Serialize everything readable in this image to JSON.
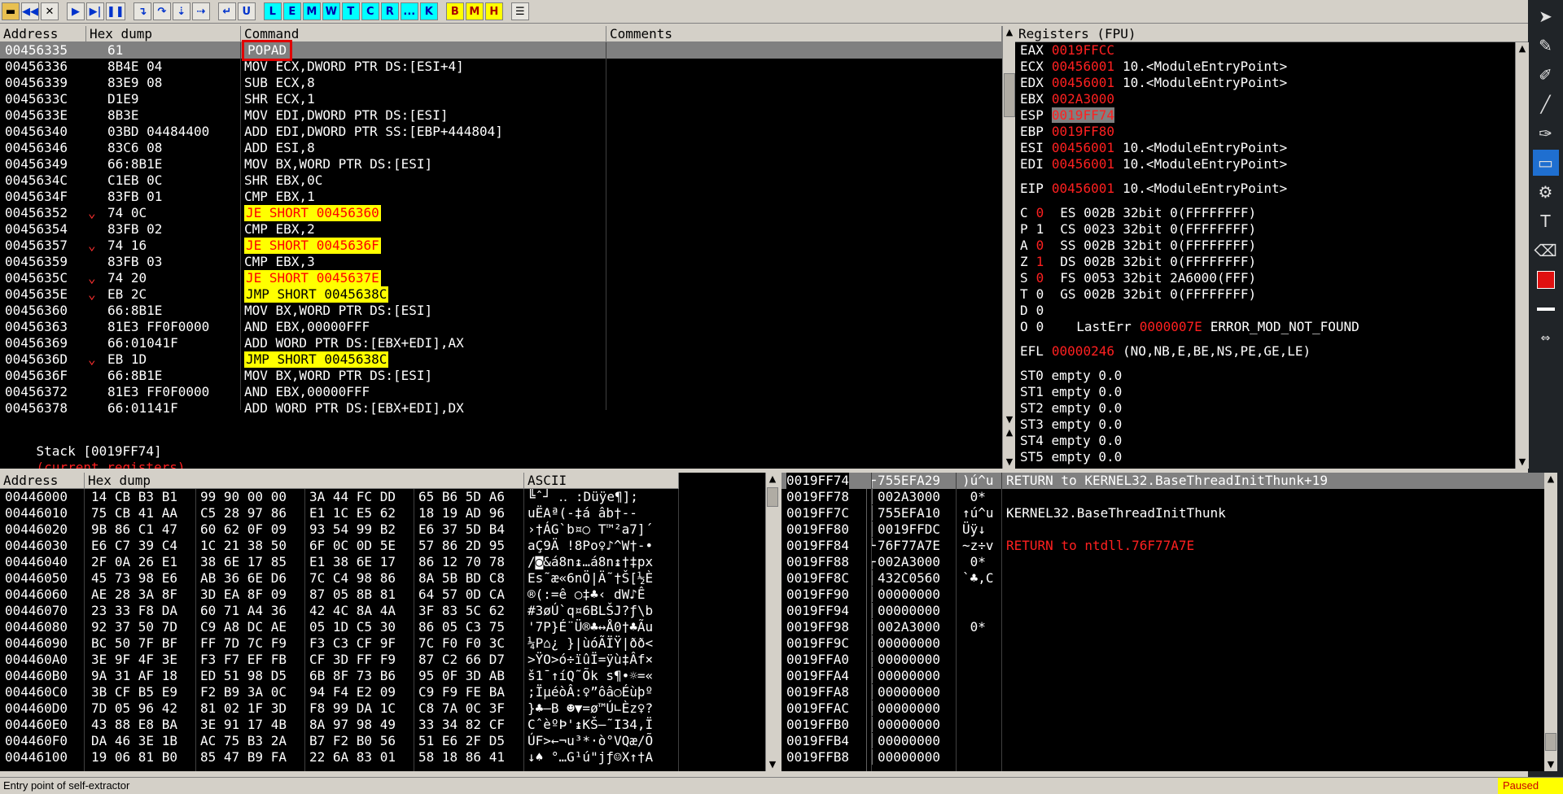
{
  "toolbar": {
    "buttons": [
      "L",
      "E",
      "M",
      "W",
      "T",
      "C",
      "R",
      "...",
      "K",
      "B",
      "M",
      "H"
    ]
  },
  "disasm": {
    "headers": {
      "address": "Address",
      "hex": "Hex dump",
      "command": "Command",
      "comments": "Comments"
    },
    "rows": [
      {
        "addr": "00456335",
        "hex": "61",
        "cmd": "POPAD",
        "style": "boxed",
        "sel": true
      },
      {
        "addr": "00456336",
        "hex": "8B4E 04",
        "cmd": "MOV ECX,DWORD PTR DS:[ESI+4]"
      },
      {
        "addr": "00456339",
        "hex": "83E9 08",
        "cmd": "SUB ECX,8"
      },
      {
        "addr": "0045633C",
        "hex": "D1E9",
        "cmd": "SHR ECX,1"
      },
      {
        "addr": "0045633E",
        "hex": "8B3E",
        "cmd": "MOV EDI,DWORD PTR DS:[ESI]"
      },
      {
        "addr": "00456340",
        "hex": "03BD 04484400",
        "cmd": "ADD EDI,DWORD PTR SS:[EBP+444804]"
      },
      {
        "addr": "00456346",
        "hex": "83C6 08",
        "cmd": "ADD ESI,8"
      },
      {
        "addr": "00456349",
        "hex": "66:8B1E",
        "cmd": "MOV BX,WORD PTR DS:[ESI]"
      },
      {
        "addr": "0045634C",
        "hex": "C1EB 0C",
        "cmd": "SHR EBX,0C"
      },
      {
        "addr": "0045634F",
        "hex": "83FB 01",
        "cmd": "CMP EBX,1"
      },
      {
        "addr": "00456352",
        "hex": "74 0C",
        "cmd": "JE SHORT 00456360",
        "style": "jmp",
        "arrow": true
      },
      {
        "addr": "00456354",
        "hex": "83FB 02",
        "cmd": "CMP EBX,2"
      },
      {
        "addr": "00456357",
        "hex": "74 16",
        "cmd": "JE SHORT 0045636F",
        "style": "jmp",
        "arrow": true
      },
      {
        "addr": "00456359",
        "hex": "83FB 03",
        "cmd": "CMP EBX,3"
      },
      {
        "addr": "0045635C",
        "hex": "74 20",
        "cmd": "JE SHORT 0045637E",
        "style": "jmp",
        "arrow": true
      },
      {
        "addr": "0045635E",
        "hex": "EB 2C",
        "cmd": "JMP SHORT 0045638C",
        "style": "jmp2",
        "arrow": true
      },
      {
        "addr": "00456360",
        "hex": "66:8B1E",
        "cmd": "MOV BX,WORD PTR DS:[ESI]"
      },
      {
        "addr": "00456363",
        "hex": "81E3 FF0F0000",
        "cmd": "AND EBX,00000FFF"
      },
      {
        "addr": "00456369",
        "hex": "66:01041F",
        "cmd": "ADD WORD PTR DS:[EBX+EDI],AX"
      },
      {
        "addr": "0045636D",
        "hex": "EB 1D",
        "cmd": "JMP SHORT 0045638C",
        "style": "jmp2",
        "arrow": true
      },
      {
        "addr": "0045636F",
        "hex": "66:8B1E",
        "cmd": "MOV BX,WORD PTR DS:[ESI]"
      },
      {
        "addr": "00456372",
        "hex": "81E3 FF0F0000",
        "cmd": "AND EBX,00000FFF"
      },
      {
        "addr": "00456378",
        "hex": "66:01141F",
        "cmd": "ADD WORD PTR DS:[EBX+EDI],DX"
      }
    ],
    "info_prefix": "Stack [0019FF74]",
    "info_suffix": "(current registers)"
  },
  "registers": {
    "title": "Registers (FPU)",
    "gp": [
      {
        "name": "EAX",
        "val": "0019FFCC",
        "rest": ""
      },
      {
        "name": "ECX",
        "val": "00456001",
        "rest": "10.<ModuleEntryPoint>"
      },
      {
        "name": "EDX",
        "val": "00456001",
        "rest": "10.<ModuleEntryPoint>"
      },
      {
        "name": "EBX",
        "val": "002A3000",
        "rest": ""
      },
      {
        "name": "ESP",
        "val": "0019FF74",
        "rest": "",
        "hl": true
      },
      {
        "name": "EBP",
        "val": "0019FF80",
        "rest": ""
      },
      {
        "name": "ESI",
        "val": "00456001",
        "rest": "10.<ModuleEntryPoint>"
      },
      {
        "name": "EDI",
        "val": "00456001",
        "rest": "10.<ModuleEntryPoint>"
      }
    ],
    "eip": {
      "name": "EIP",
      "val": "00456001",
      "rest": "10.<ModuleEntryPoint>"
    },
    "flags": [
      {
        "f": "C",
        "v": "0",
        "red": true,
        "seg": "ES 002B 32bit 0(FFFFFFFF)"
      },
      {
        "f": "P",
        "v": "1",
        "red": false,
        "seg": "CS 0023 32bit 0(FFFFFFFF)"
      },
      {
        "f": "A",
        "v": "0",
        "red": true,
        "seg": "SS 002B 32bit 0(FFFFFFFF)"
      },
      {
        "f": "Z",
        "v": "1",
        "red": true,
        "seg": "DS 002B 32bit 0(FFFFFFFF)"
      },
      {
        "f": "S",
        "v": "0",
        "red": true,
        "seg": "FS 0053 32bit 2A6000(FFF)"
      },
      {
        "f": "T",
        "v": "0",
        "red": false,
        "seg": "GS 002B 32bit 0(FFFFFFFF)"
      },
      {
        "f": "D",
        "v": "0",
        "red": false,
        "seg": ""
      },
      {
        "f": "O",
        "v": "0",
        "red": false,
        "seg": ""
      }
    ],
    "lasterr": {
      "label": "LastErr",
      "val": "0000007E",
      "text": "ERROR_MOD_NOT_FOUND"
    },
    "efl": {
      "label": "EFL",
      "val": "00000246",
      "text": "(NO,NB,E,BE,NS,PE,GE,LE)"
    },
    "fpu": [
      "ST0 empty 0.0",
      "ST1 empty 0.0",
      "ST2 empty 0.0",
      "ST3 empty 0.0",
      "ST4 empty 0.0",
      "ST5 empty 0.0"
    ]
  },
  "dump": {
    "headers": {
      "address": "Address",
      "hex": "Hex dump",
      "ascii": "ASCII"
    },
    "rows": [
      {
        "addr": "00446000",
        "h1": "14 CB B3 B1",
        "h2": "99 90 00 00",
        "h3": "3A 44 FC DD",
        "h4": "65 B6 5D A6",
        "ascii": "╚ˆ┘ ‥ :Düÿe¶];"
      },
      {
        "addr": "00446010",
        "h1": "75 CB 41 AA",
        "h2": "C5 28 97 86",
        "h3": "E1 1C E5 62",
        "h4": "18 19 AD 96",
        "ascii": "uËAª(-‡á âb†--"
      },
      {
        "addr": "00446020",
        "h1": "9B 86 C1 47",
        "h2": "60 62 0F 09",
        "h3": "93 54 99 B2",
        "h4": "E6 37 5D B4",
        "ascii": "›†ÁG`b¤○ T™²a7]´"
      },
      {
        "addr": "00446030",
        "h1": "E6 C7 39 C4",
        "h2": "1C 21 38 50",
        "h3": "6F 0C 0D 5E",
        "h4": "57 86 2D 95",
        "ascii": "aÇ9Ä !8Po♀♪^W†-•"
      },
      {
        "addr": "00446040",
        "h1": "2F 0A 26 E1",
        "h2": "38 6E 17 85",
        "h3": "E1 38 6E 17",
        "h4": "86 12 70 78",
        "ascii": "/◙&á8n↨…á8n↨†‡px"
      },
      {
        "addr": "00446050",
        "h1": "45 73 98 E6",
        "h2": "AB 36 6E D6",
        "h3": "7C C4 98 86",
        "h4": "8A 5B BD C8",
        "ascii": "Es˜æ«6nÖ|Ä˜†Š[½È"
      },
      {
        "addr": "00446060",
        "h1": "AE 28 3A 8F",
        "h2": "3D EA 8F 09",
        "h3": "87 05 8B 81",
        "h4": "64 57 0D CA",
        "ascii": "®(:=ê ○‡♣‹ dW♪Ê"
      },
      {
        "addr": "00446070",
        "h1": "23 33 F8 DA",
        "h2": "60 71 A4 36",
        "h3": "42 4C 8A 4A",
        "h4": "3F 83 5C 62",
        "ascii": "#3øÚ`q¤6BLŠJ?ƒ\\b"
      },
      {
        "addr": "00446080",
        "h1": "92 37 50 7D",
        "h2": "C9 A8 DC AE",
        "h3": "05 1D C5 30",
        "h4": "86 05 C3 75",
        "ascii": "'7P}É¨Ü®♣↔Å0†♣Ãu"
      },
      {
        "addr": "00446090",
        "h1": "BC 50 7F BF",
        "h2": "FF 7D 7C F9",
        "h3": "F3 C3 CF 9F",
        "h4": "7C F0 F0 3C",
        "ascii": "¼P⌂¿ }|ùóÃÏŸ|ðð<"
      },
      {
        "addr": "004460A0",
        "h1": "3E 9F 4F 3E",
        "h2": "F3 F7 EF FB",
        "h3": "CF 3D FF F9",
        "h4": "87 C2 66 D7",
        "ascii": ">ŸO>ó÷ïûÏ=ÿù‡Âf×"
      },
      {
        "addr": "004460B0",
        "h1": "9A 31 AF 18",
        "h2": "ED 51 98 D5",
        "h3": "6B 8F 73 B6",
        "h4": "95 0F 3D AB",
        "ascii": "š1¯↑íQ˜Õk s¶•☼=«"
      },
      {
        "addr": "004460C0",
        "h1": "3B CF B5 E9",
        "h2": "F2 B9 3A 0C",
        "h3": "94 F4 E2 09",
        "h4": "C9 F9 FE BA",
        "ascii": ";ÏµéòÂ:♀”ôâ○Éùþº"
      },
      {
        "addr": "004460D0",
        "h1": "7D 05 96 42",
        "h2": "81 02 1F 3D",
        "h3": "F8 99 DA 1C",
        "h4": "C8 7A 0C 3F",
        "ascii": "}♣–B ☻▼=ø™Ú∟Èz♀?"
      },
      {
        "addr": "004460E0",
        "h1": "43 88 E8 BA",
        "h2": "3E 91 17 4B",
        "h3": "8A 97 98 49",
        "h4": "33 34 82 CF",
        "ascii": "CˆèºÞ'↨KŠ—˜I34‚Ï"
      },
      {
        "addr": "004460F0",
        "h1": "DA 46 3E 1B",
        "h2": "AC 75 B3 2A",
        "h3": "B7 F2 B0 56",
        "h4": "51 E6 2F D5",
        "ascii": "ÚF>←¬u³*·ò°VQæ/Õ"
      },
      {
        "addr": "00446100",
        "h1": "19 06 81 B0",
        "h2": "85 47 B9 FA",
        "h3": "22 6A 83 01",
        "h4": "58 18 86 41",
        "ascii": "↓♠ °…G¹ú\"jƒ☺X↑†A"
      }
    ]
  },
  "stack": {
    "rows": [
      {
        "addr": "0019FF74",
        "val": "755EFA29",
        "asc": ")ú^u",
        "cmt": "RETURN to KERNEL32.BaseThreadInitThunk+19",
        "red": false,
        "sel": true,
        "brk": "┌"
      },
      {
        "addr": "0019FF78",
        "val": "002A3000",
        "asc": " 0*",
        "cmt": "",
        "brk": "│"
      },
      {
        "addr": "0019FF7C",
        "val": "755EFA10",
        "asc": "↑ú^u",
        "cmt": "KERNEL32.BaseThreadInitThunk",
        "brk": "│"
      },
      {
        "addr": "0019FF80",
        "val": "0019FFDC",
        "asc": "Üÿ↓",
        "cmt": "",
        "brk": "│"
      },
      {
        "addr": "0019FF84",
        "val": "76F77A7E",
        "asc": "~z÷v",
        "cmt": "RETURN to ntdll.76F77A7E",
        "red": true,
        "brk": "└"
      },
      {
        "addr": "0019FF88",
        "val": "002A3000",
        "asc": " 0*",
        "cmt": "",
        "brk": "┌"
      },
      {
        "addr": "0019FF8C",
        "val": "432C0560",
        "asc": "`♣,C",
        "cmt": "",
        "brk": "│"
      },
      {
        "addr": "0019FF90",
        "val": "00000000",
        "asc": "",
        "cmt": "",
        "brk": "│"
      },
      {
        "addr": "0019FF94",
        "val": "00000000",
        "asc": "",
        "cmt": "",
        "brk": "│"
      },
      {
        "addr": "0019FF98",
        "val": "002A3000",
        "asc": " 0*",
        "cmt": "",
        "brk": "│"
      },
      {
        "addr": "0019FF9C",
        "val": "00000000",
        "asc": "",
        "cmt": "",
        "brk": "│"
      },
      {
        "addr": "0019FFA0",
        "val": "00000000",
        "asc": "",
        "cmt": "",
        "brk": "│"
      },
      {
        "addr": "0019FFA4",
        "val": "00000000",
        "asc": "",
        "cmt": "",
        "brk": "│"
      },
      {
        "addr": "0019FFA8",
        "val": "00000000",
        "asc": "",
        "cmt": "",
        "brk": "│"
      },
      {
        "addr": "0019FFAC",
        "val": "00000000",
        "asc": "",
        "cmt": "",
        "brk": "│"
      },
      {
        "addr": "0019FFB0",
        "val": "00000000",
        "asc": "",
        "cmt": "",
        "brk": "│"
      },
      {
        "addr": "0019FFB4",
        "val": "00000000",
        "asc": "",
        "cmt": "",
        "brk": "│"
      },
      {
        "addr": "0019FFB8",
        "val": "00000000",
        "asc": "",
        "cmt": "",
        "brk": "│"
      }
    ]
  },
  "status": {
    "message": "Entry point of self-extractor",
    "state": "Paused"
  }
}
